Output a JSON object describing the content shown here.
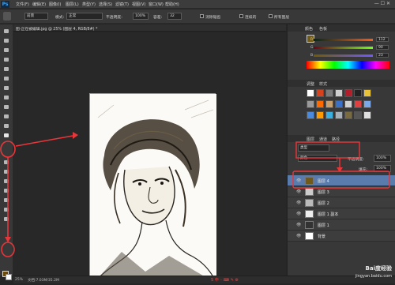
{
  "app": {
    "logo": "Ps"
  },
  "menubar": {
    "items": [
      "文件(F)",
      "编辑(E)",
      "图像(I)",
      "图层(L)",
      "类型(Y)",
      "选择(S)",
      "滤镜(T)",
      "视图(V)",
      "窗口(W)",
      "帮助(H)"
    ]
  },
  "options_bar": {
    "preset_value": "前景",
    "mode_label": "模式:",
    "mode_value": "正常",
    "opacity_label": "不透明度:",
    "opacity_value": "100%",
    "tolerance_label": "容差:",
    "tolerance_value": "32",
    "antialias_label": "消除锯齿",
    "contiguous_label": "连续的",
    "all_layers_label": "所有图层"
  },
  "document": {
    "tab_title": "图-正在被编辑.jpg @ 25% (图层 4, RGB/8#) *"
  },
  "color_panel": {
    "tabs": [
      "颜色",
      "色板"
    ],
    "r_value": "112",
    "g_value": "90",
    "b_value": "23",
    "fg_color": "#705a17"
  },
  "styles_panel": {
    "tabs": [
      "调整",
      "样式"
    ]
  },
  "layers_panel": {
    "tabs": [
      "图层",
      "通道",
      "路径"
    ],
    "kind_value": "类型",
    "blend_value": "颜色",
    "opacity_label": "不透明度:",
    "opacity_value": "100%",
    "fill_label": "填充:",
    "fill_value": "100%",
    "layers": [
      {
        "name": "图层 4",
        "selected": true
      },
      {
        "name": "图层 3",
        "selected": false
      },
      {
        "name": "图层 2",
        "selected": false
      },
      {
        "name": "图层 1 副本",
        "selected": false
      },
      {
        "name": "图层 1",
        "selected": false
      },
      {
        "name": "背景",
        "selected": false
      }
    ]
  },
  "statusbar": {
    "zoom": "25%",
    "doc_info": "文档:7.03M/35.2M"
  },
  "watermark": {
    "brand": "Bai度经验",
    "url": "jingyan.baidu.com"
  }
}
